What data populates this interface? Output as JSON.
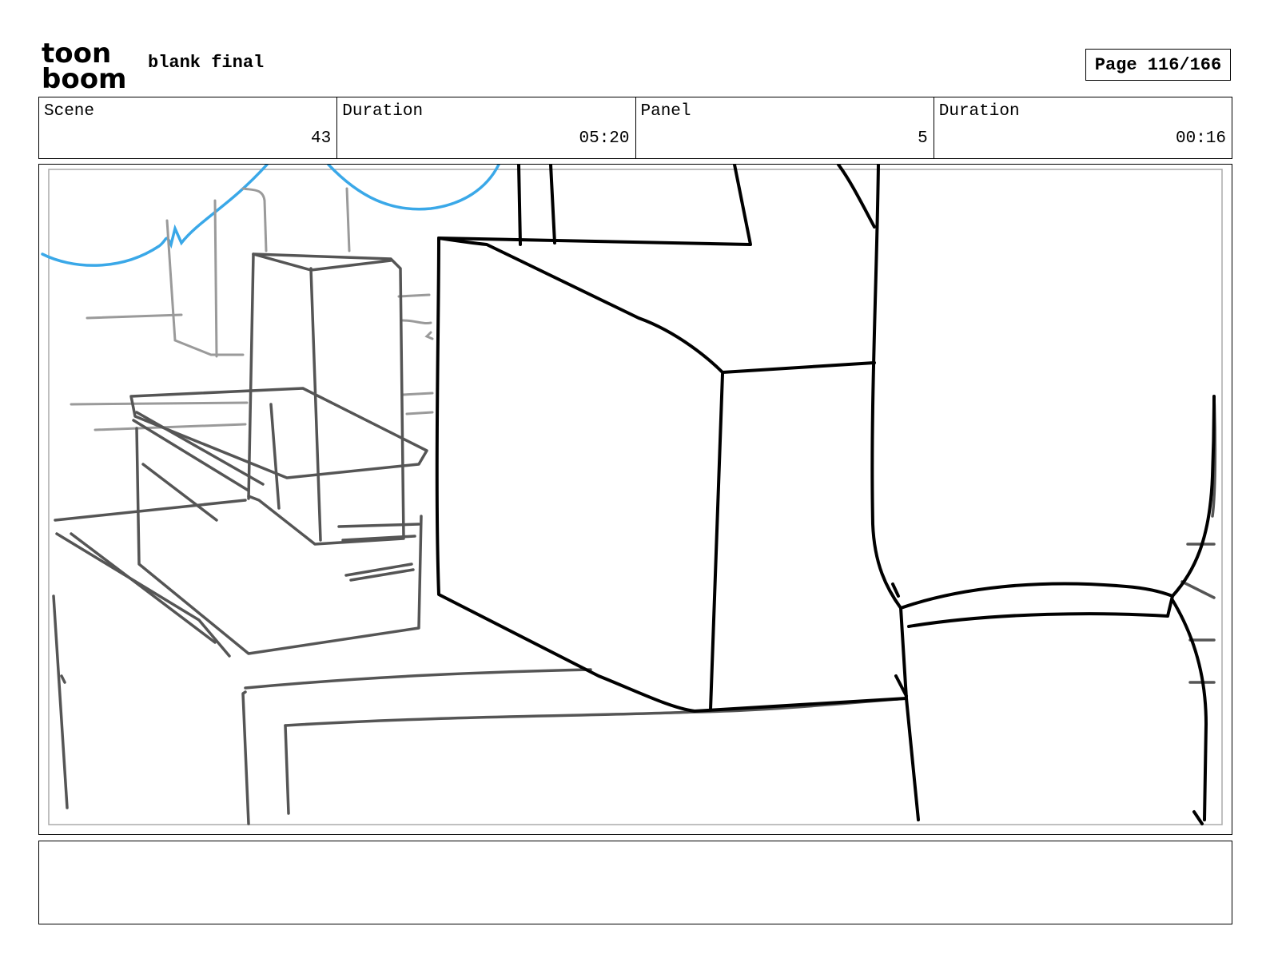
{
  "header": {
    "logo_line1": "toon",
    "logo_line2": "boom",
    "project_title": "blank final",
    "page_label": "Page 116/166"
  },
  "info": {
    "scene_label": "Scene",
    "scene_value": "43",
    "scene_duration_label": "Duration",
    "scene_duration_value": "05:20",
    "panel_label": "Panel",
    "panel_value": "5",
    "panel_duration_label": "Duration",
    "panel_duration_value": "00:16"
  },
  "notes": {
    "text": ""
  },
  "colors": {
    "sketch_dark": "#000000",
    "sketch_grey": "#5a5a5a",
    "sketch_light": "#9a9a9a",
    "sketch_blue": "#3aa8e8"
  }
}
